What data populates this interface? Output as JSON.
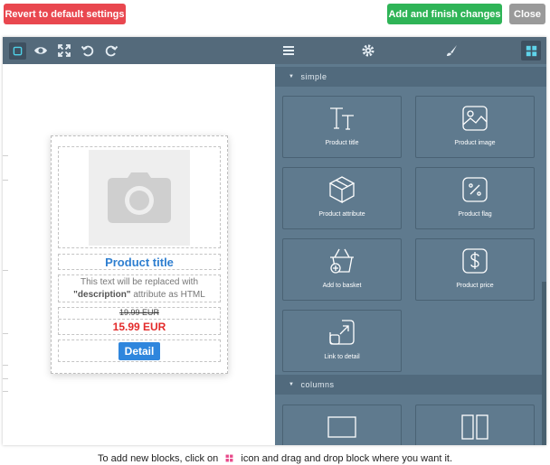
{
  "actions": {
    "revert_label": "Revert to default settings",
    "add_label": "Add and finish changes",
    "close_label": "Close"
  },
  "toolbar": {
    "icons": [
      "select-icon",
      "preview-eye-icon",
      "fullscreen-icon",
      "undo-icon",
      "redo-icon"
    ],
    "panel_icons": [
      "menu-icon",
      "gear-icon",
      "brush-icon",
      "blocks-grid-icon"
    ]
  },
  "product_card": {
    "title": "Product title",
    "description_prefix": "This text will be replaced with",
    "description_keyword": "\"description\"",
    "description_suffix": "attribute as HTML",
    "old_price": "19.99 EUR",
    "new_price": "15.99 EUR",
    "detail_label": "Detail"
  },
  "blocks_panel": {
    "sections": [
      {
        "label": "simple",
        "expanded": true
      },
      {
        "label": "columns",
        "expanded": true
      }
    ],
    "blocks": [
      {
        "label": "Product title",
        "icon": "title-text-icon"
      },
      {
        "label": "Product image",
        "icon": "image-icon"
      },
      {
        "label": "Product attribute",
        "icon": "cubes-icon"
      },
      {
        "label": "Product flag",
        "icon": "percent-icon"
      },
      {
        "label": "Add to basket",
        "icon": "basket-add-icon"
      },
      {
        "label": "Product price",
        "icon": "dollar-icon"
      },
      {
        "label": "Link to detail",
        "icon": "external-link-icon"
      }
    ],
    "column_blocks": [
      {
        "icon": "one-column-icon"
      },
      {
        "icon": "two-column-icon"
      }
    ]
  },
  "footer": {
    "text_before": "To add new blocks, click on",
    "text_after": "icon and drag and drop block where you want it."
  },
  "colors": {
    "revert": "#e9474f",
    "add": "#2fb457",
    "close": "#9a9a9a",
    "panel": "#5f7a8e",
    "toolbar": "#546a7b",
    "price_new": "#e32b2b",
    "link_blue": "#2f7fd0"
  }
}
